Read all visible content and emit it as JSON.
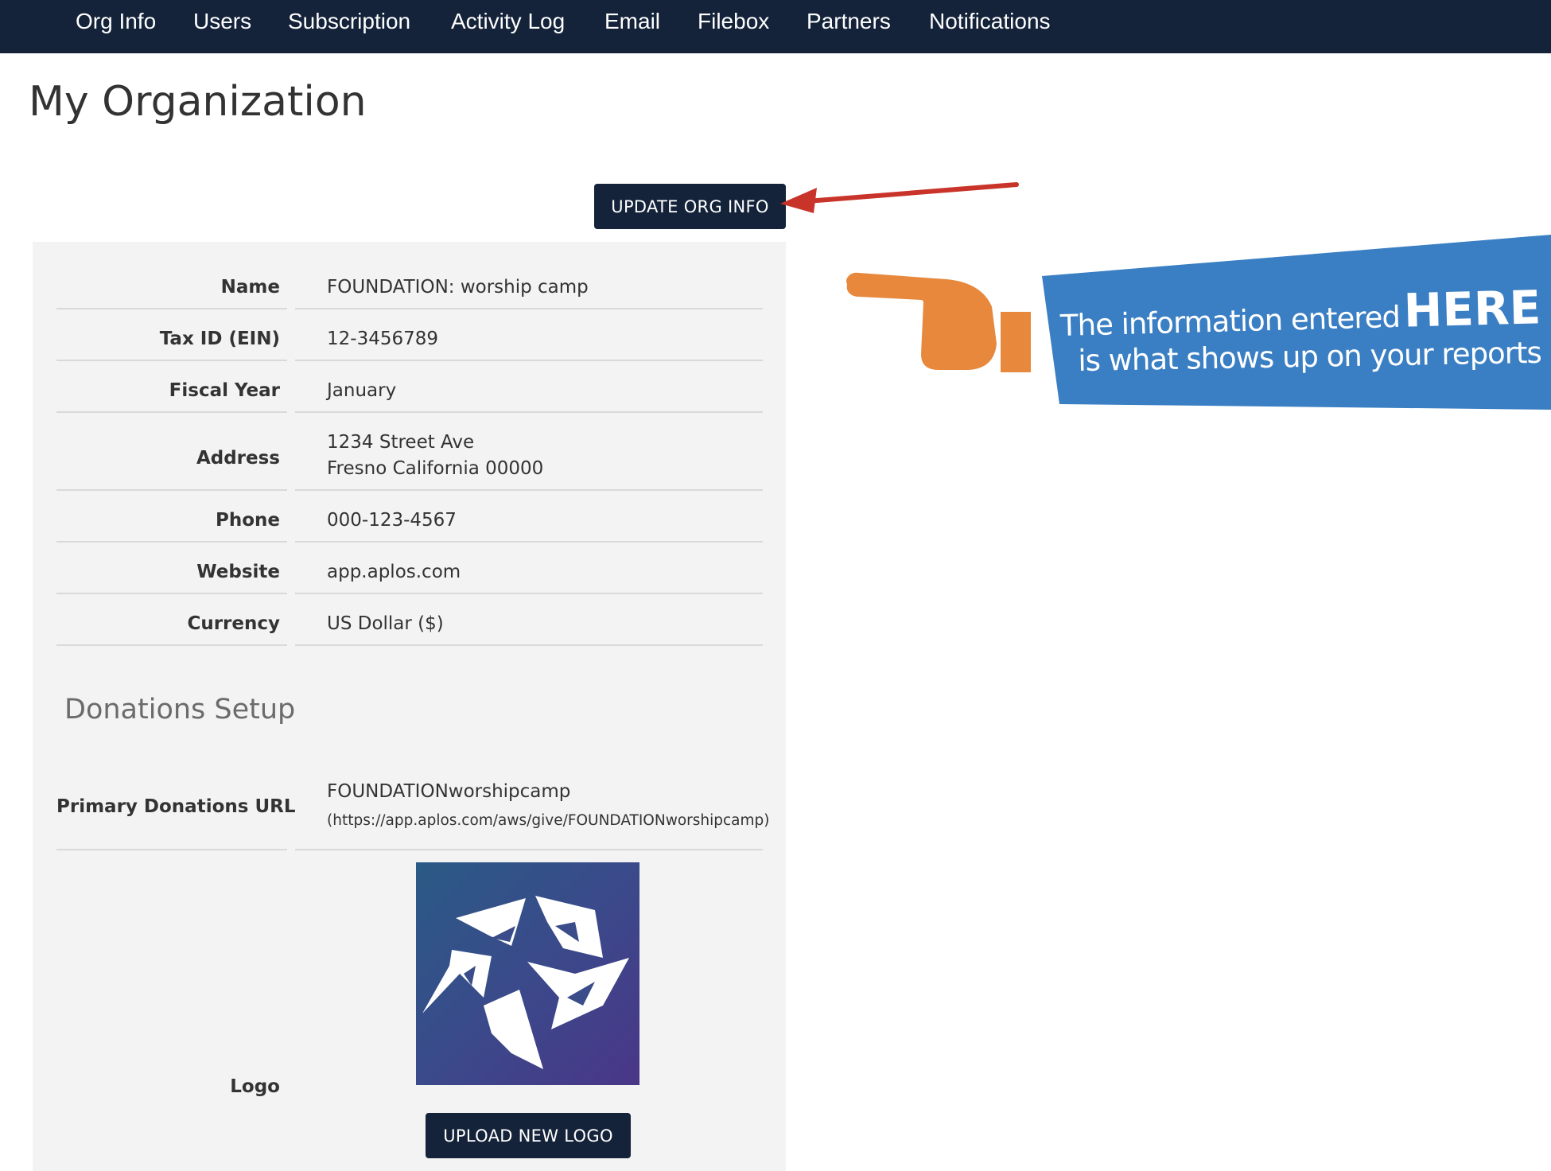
{
  "nav": {
    "items": [
      "Org Info",
      "Users",
      "Subscription",
      "Activity Log",
      "Email",
      "Filebox",
      "Partners",
      "Notifications"
    ]
  },
  "page": {
    "title": "My Organization"
  },
  "actions": {
    "update_label": "UPDATE ORG INFO",
    "upload_logo_label": "UPLOAD NEW LOGO"
  },
  "org": {
    "name": {
      "label": "Name",
      "value": "FOUNDATION: worship camp"
    },
    "tax_id": {
      "label": "Tax ID (EIN)",
      "value": "12-3456789"
    },
    "fiscal_year": {
      "label": "Fiscal Year",
      "value": "January"
    },
    "address": {
      "label": "Address",
      "line1": "1234 Street Ave",
      "line2": "Fresno California 00000"
    },
    "phone": {
      "label": "Phone",
      "value": "000-123-4567"
    },
    "website": {
      "label": "Website",
      "value": "app.aplos.com"
    },
    "currency": {
      "label": "Currency",
      "value": "US Dollar ($)"
    }
  },
  "donations": {
    "title": "Donations Setup",
    "url_label": "Primary Donations URL",
    "url_slug": "FOUNDATIONworshipcamp",
    "url_full": "(https://app.aplos.com/aws/give/FOUNDATIONworshipcamp)",
    "logo_label": "Logo"
  },
  "callout": {
    "line1": "The information entered",
    "emphasis": "HERE",
    "line2": "is what shows up on your reports"
  },
  "colors": {
    "nav_bg": "#14233a",
    "button_bg": "#14233a",
    "panel_bg": "#f3f3f3",
    "callout_bg": "#3a7fc3",
    "hand": "#e8883c",
    "arrow": "#c9342a"
  },
  "icons": {
    "arrow": "arrow-left-icon",
    "hand": "pointing-hand-icon",
    "logo": "org-logo"
  }
}
